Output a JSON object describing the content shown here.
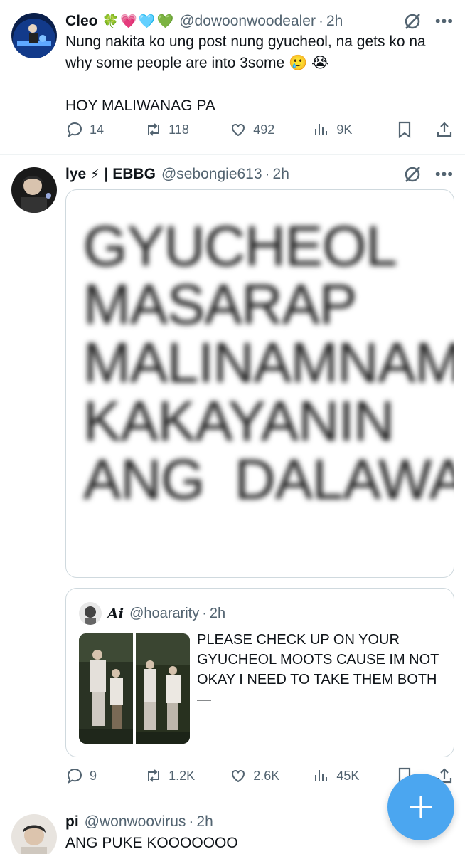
{
  "tweets": [
    {
      "name": "Cleo",
      "badges": [
        "🍀",
        "💗",
        "🩵",
        "💚"
      ],
      "handle": "@dowoonwoodealer",
      "dot": "·",
      "time": "2h",
      "text": "Nung nakita ko ung post nung gyucheol, na gets ko na why some people are into 3some 🥲 😭\n\nHOY MALIWANAG PA",
      "replies": "14",
      "reposts": "118",
      "likes": "492",
      "views": "9K"
    },
    {
      "name": "lye",
      "badges": [
        "⚡"
      ],
      "name_suffix": "| EBBG",
      "handle": "@sebongie613",
      "dot": "·",
      "time": "2h",
      "media_text": "GYUCHEOL\nMASARAP\nMALINAMNAM\nKAKAYANIN\nANG  DALAWA",
      "quote": {
        "name": "Ai",
        "handle": "@hoararity",
        "dot": "·",
        "time": "2h",
        "text": "PLEASE CHECK UP ON YOUR GYUCHEOL MOOTS CAUSE IM NOT OKAY I NEED TO TAKE THEM BOTH—"
      },
      "replies": "9",
      "reposts": "1.2K",
      "likes": "2.6K",
      "views": "45K"
    },
    {
      "name": "pi",
      "handle": "@wonwoovirus",
      "dot": "·",
      "time": "2h",
      "text": "ANG PUKE KOOOOOOO"
    }
  ],
  "more_glyph": "•••",
  "colors": {
    "secondary_text": "#536471",
    "divider": "#eff3f4",
    "fab": "#4ba6f0"
  },
  "icons": [
    "reply-icon",
    "repost-icon",
    "like-icon",
    "views-icon",
    "bookmark-icon",
    "share-icon",
    "grok-icon",
    "more-icon",
    "compose-plus-icon"
  ]
}
